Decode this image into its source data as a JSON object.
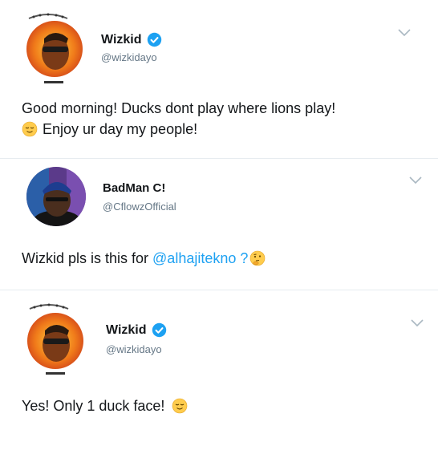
{
  "tweets": [
    {
      "name": "Wizkid",
      "handle": "@wizkidayo",
      "verified": true,
      "text_line1": "Good morning! Ducks dont play where lions play!",
      "text_line2": "Enjoy ur day my people!",
      "emoji": "relieved-face-emoji"
    },
    {
      "name": "BadMan C!",
      "handle": "@CflowzOfficial",
      "verified": false,
      "text_before": "Wizkid pls is this for ",
      "mention": "@alhajitekno",
      "text_after": " ?",
      "emoji": "thinking-face-emoji"
    },
    {
      "name": "Wizkid",
      "handle": "@wizkidayo",
      "verified": true,
      "text": "Yes! Only 1 duck face!",
      "emoji": "relieved-face-emoji"
    }
  ],
  "colors": {
    "link": "#1da1f2",
    "verified": "#1da1f2",
    "secondary_text": "#657786",
    "divider": "#e6ecf0"
  }
}
